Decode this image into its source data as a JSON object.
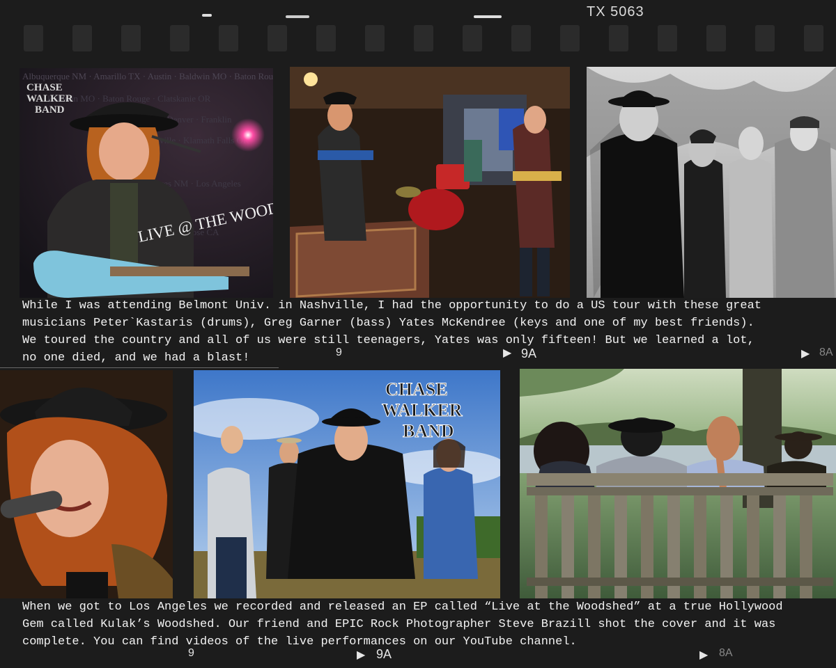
{
  "film": {
    "top_code": "TX 5063",
    "frame_mark_1": "9",
    "frame_mark_2": "9A",
    "frame_mark_3": "8A"
  },
  "photos": {
    "album_cover": {
      "band_logo": "CHASE WALKER BAND",
      "album_title": "LIVE @ THE WOODSHED",
      "tour_cities": "Albuquerque NM · Amarillo TX · Austin · Baldwin MO · Baton Rouge · Clatskanie OR · Cornelius · Denver · Franklin · Huntsville · Klamath Falls OR · Las Cruces NM · Los Angeles · San Jose"
    },
    "band_poster": {
      "band_logo": "CHASE WALKER BAND"
    }
  },
  "captions": {
    "first": "While I was attending Belmont Univ. in Nashville, I had the opportunity to do a US tour with these great\nmusicians Peter`Kastaris (drums), Greg Garner (bass) Yates McKendree (keys and one of my best friends).\nWe toured the country and all of us were still teenagers, Yates was only fifteen! But we learned a lot,\nno one died, and we had a blast!",
    "second": "When we got to Los Angeles we recorded and released an EP called “Live at the Woodshed” at a true Hollywood\nGem called Kulak’s Woodshed. Our friend and EPIC Rock Photographer Steve Brazill shot the cover and it was\ncomplete. You can find videos of the live performances on our YouTube channel."
  }
}
